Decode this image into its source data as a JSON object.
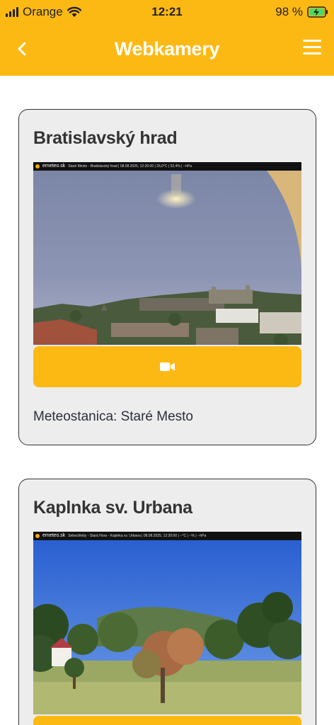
{
  "status_bar": {
    "carrier": "Orange",
    "time": "12:21",
    "battery": "98 %"
  },
  "header": {
    "title": "Webkamery",
    "back_icon": "chevron-left-icon",
    "menu_icon": "hamburger-menu-icon"
  },
  "cards": [
    {
      "title": "Bratislavský hrad",
      "cam_brand": "emeteo.sk",
      "cam_caption": "Staré Mesto - Bratislavský hrad | 08.08.2025, 12:20:00 | 26,0°C | 52,4% | --hPa",
      "station": "Meteostanica: Staré Mesto"
    },
    {
      "title": "Kaplnka sv. Urbana",
      "cam_brand": "emeteo.sk",
      "cam_caption": "Sebechleby - Stará Hora - Kaplnka sv. Urbana | 08.08.2025, 12:20:00 | --°C | --% | --hPa"
    }
  ],
  "colors": {
    "accent": "#FDB913",
    "card_bg": "#EDEDEE",
    "header_text": "#ffffff"
  }
}
